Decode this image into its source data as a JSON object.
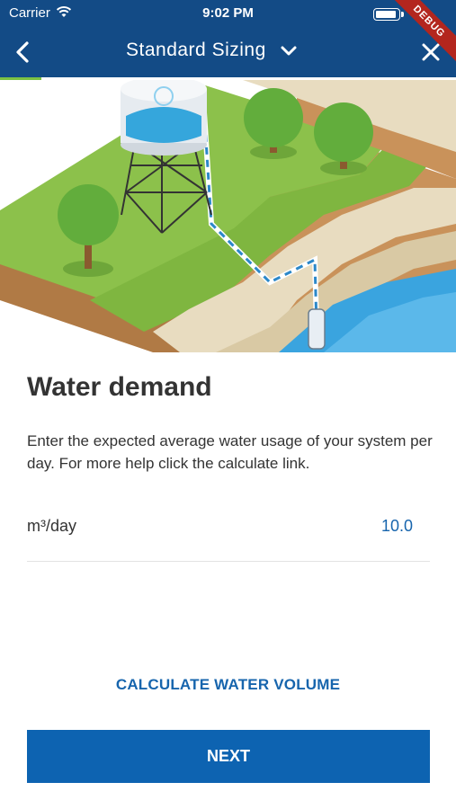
{
  "status_bar": {
    "carrier": "Carrier",
    "time": "9:02 PM"
  },
  "nav": {
    "title": "Standard Sizing",
    "back_icon": "chevron-left-icon",
    "dropdown_icon": "chevron-down-icon",
    "close_icon": "close-icon"
  },
  "debug_banner": "DEBUG",
  "progress": {
    "fraction": 0.09
  },
  "content": {
    "heading": "Water demand",
    "description": "Enter the expected average water usage of your system per day. For more help click the calculate link.",
    "demand": {
      "unit_label": "m³/day",
      "value": "10.0"
    },
    "calculate_link": "CALCULATE WATER VOLUME",
    "next_button": "NEXT"
  },
  "colors": {
    "nav_bg": "#134b86",
    "accent_blue": "#1765ad",
    "button_blue": "#0d63b1",
    "progress_green": "#7bc143",
    "debug_red": "#b3261e"
  }
}
